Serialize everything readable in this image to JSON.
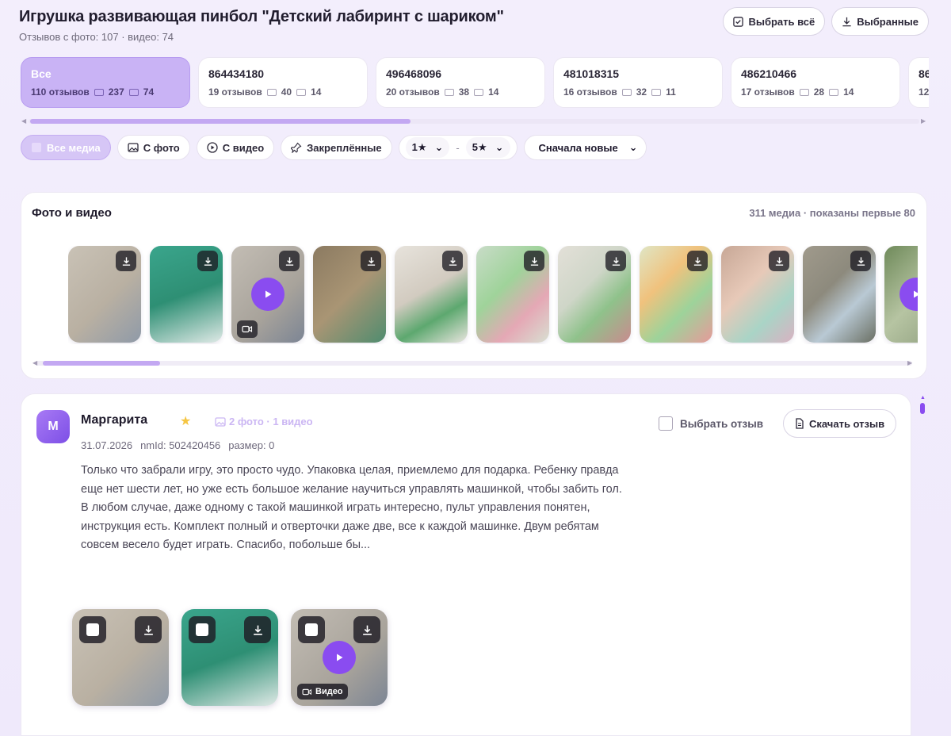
{
  "header": {
    "title": "Игрушка развивающая пинбол \"Детский лабиринт с шариком\"",
    "subtitle": "Отзывов с фото: 107 · видео: 74",
    "select_all_label": "Выбрать всё",
    "selected_label": "Выбранные"
  },
  "variants": [
    {
      "id": "Все",
      "reviews": "110 отзывов",
      "photos": "237",
      "videos": "74",
      "active": true
    },
    {
      "id": "864434180",
      "reviews": "19 отзывов",
      "photos": "40",
      "videos": "14"
    },
    {
      "id": "496468096",
      "reviews": "20 отзывов",
      "photos": "38",
      "videos": "14"
    },
    {
      "id": "481018315",
      "reviews": "16 отзывов",
      "photos": "32",
      "videos": "11"
    },
    {
      "id": "486210466",
      "reviews": "17 отзывов",
      "photos": "28",
      "videos": "14"
    },
    {
      "id": "86",
      "reviews": "12",
      "photos": "",
      "videos": ""
    }
  ],
  "filters": {
    "all_media": "Все медиа",
    "with_photo": "С фото",
    "with_video": "С видео",
    "pinned": "Закреплённые",
    "rating_from": "1★",
    "rating_dash": "-",
    "rating_to": "5★",
    "sort": "Сначала новые"
  },
  "media_panel": {
    "title": "Фото и видео",
    "count": "311 медиа · показаны первые 80"
  },
  "review": {
    "avatar_letter": "М",
    "author": "Маргарита",
    "star": "★",
    "media_badge": "2 фото · 1 видео",
    "date": "31.07.2026",
    "nmid": "nmId: 502420456",
    "size": "размер: 0",
    "text": "Только что забрали игру, это просто чудо. Упаковка целая, приемлемо для подарка. Ребенку правда еще нет шести лет, но уже есть большое желание научиться управлять машинкой, чтобы забить гол. В любом случае, даже одному с такой машинкой играть интересно, пульт управления понятен, инструкция есть. Комплект полный и отверточки даже две, все к каждой машинке. Двум ребятам совсем весело будет играть. Спасибо, побольше бы...",
    "select_label": "Выбрать отзыв",
    "download_label": "Скачать отзыв",
    "video_tag": "Видео"
  },
  "colors": {
    "accent": "#8a4cf0",
    "accent_light": "#c9b3f5",
    "star": "#f5c542"
  }
}
